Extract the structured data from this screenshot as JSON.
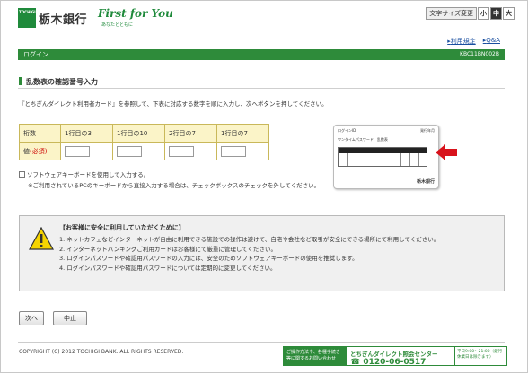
{
  "header": {
    "logo_mark": "TOCHIGI",
    "bank_name": "栃木銀行",
    "brand": "First for You",
    "brand_sub": "あなたとともに",
    "fontsize_label": "文字サイズ変更",
    "fontsize_options": [
      "小",
      "中",
      "大"
    ],
    "links": [
      "利用規定",
      "Q&A"
    ]
  },
  "bar": {
    "title": "ログイン",
    "code": "KBC11BN002B"
  },
  "section_title": "乱数表の確認番号入力",
  "instruction": "『とちぎんダイレクト利用者カード』を参照して、下表に対応する数字を順に入力し、次へボタンを押してください。",
  "table": {
    "header": [
      "桁数",
      "1行目の3",
      "1行目の10",
      "2行目の7",
      "1行目の7"
    ],
    "value_label": "値",
    "required": "(必須)",
    "values": [
      "",
      "",
      "",
      ""
    ]
  },
  "checkbox_label": "ソフトウェアキーボードを使用して入力する。",
  "checkbox_note": "※ご利用されているPCのキーボードから直接入力する場合は、チェックボックスのチェックを外してください。",
  "card": {
    "top_left": "ログインID",
    "top_right": "発行年月",
    "line2": "ワンタイムパスワード　乱数表",
    "foot": "",
    "bank": "栃木銀行"
  },
  "notice": {
    "title": "【お客様に安全に利用していただくために】",
    "items": [
      "1. ネットカフェなどインターネットが自由に利用できる施設での操作は避けて、自宅や会社など取引が安全にできる場所にて利用してください。",
      "2. インターネットバンキングご利用カードはお客様にて厳重に管理してください。",
      "3. ログインパスワードや確認用パスワードの入力には、安全のためソフトウェアキーボードの使用を推奨します。",
      "4. ログインパスワードや確認用パスワードについては定期的に変更してください。"
    ]
  },
  "buttons": {
    "next": "次へ",
    "cancel": "中止"
  },
  "footer": {
    "copyright": "COPYRIGHT (C) 2012 TOCHIGI BANK. ALL RIGHTS RESERVED.",
    "contact_left": "ご操作方法や、各種手続き等に関するお問い合わせ",
    "center_name": "とちぎんダイレクト照会センター",
    "phone": "0120-06-0517",
    "hours": "平日9:00～21:00（銀行休業日は除きます）"
  }
}
